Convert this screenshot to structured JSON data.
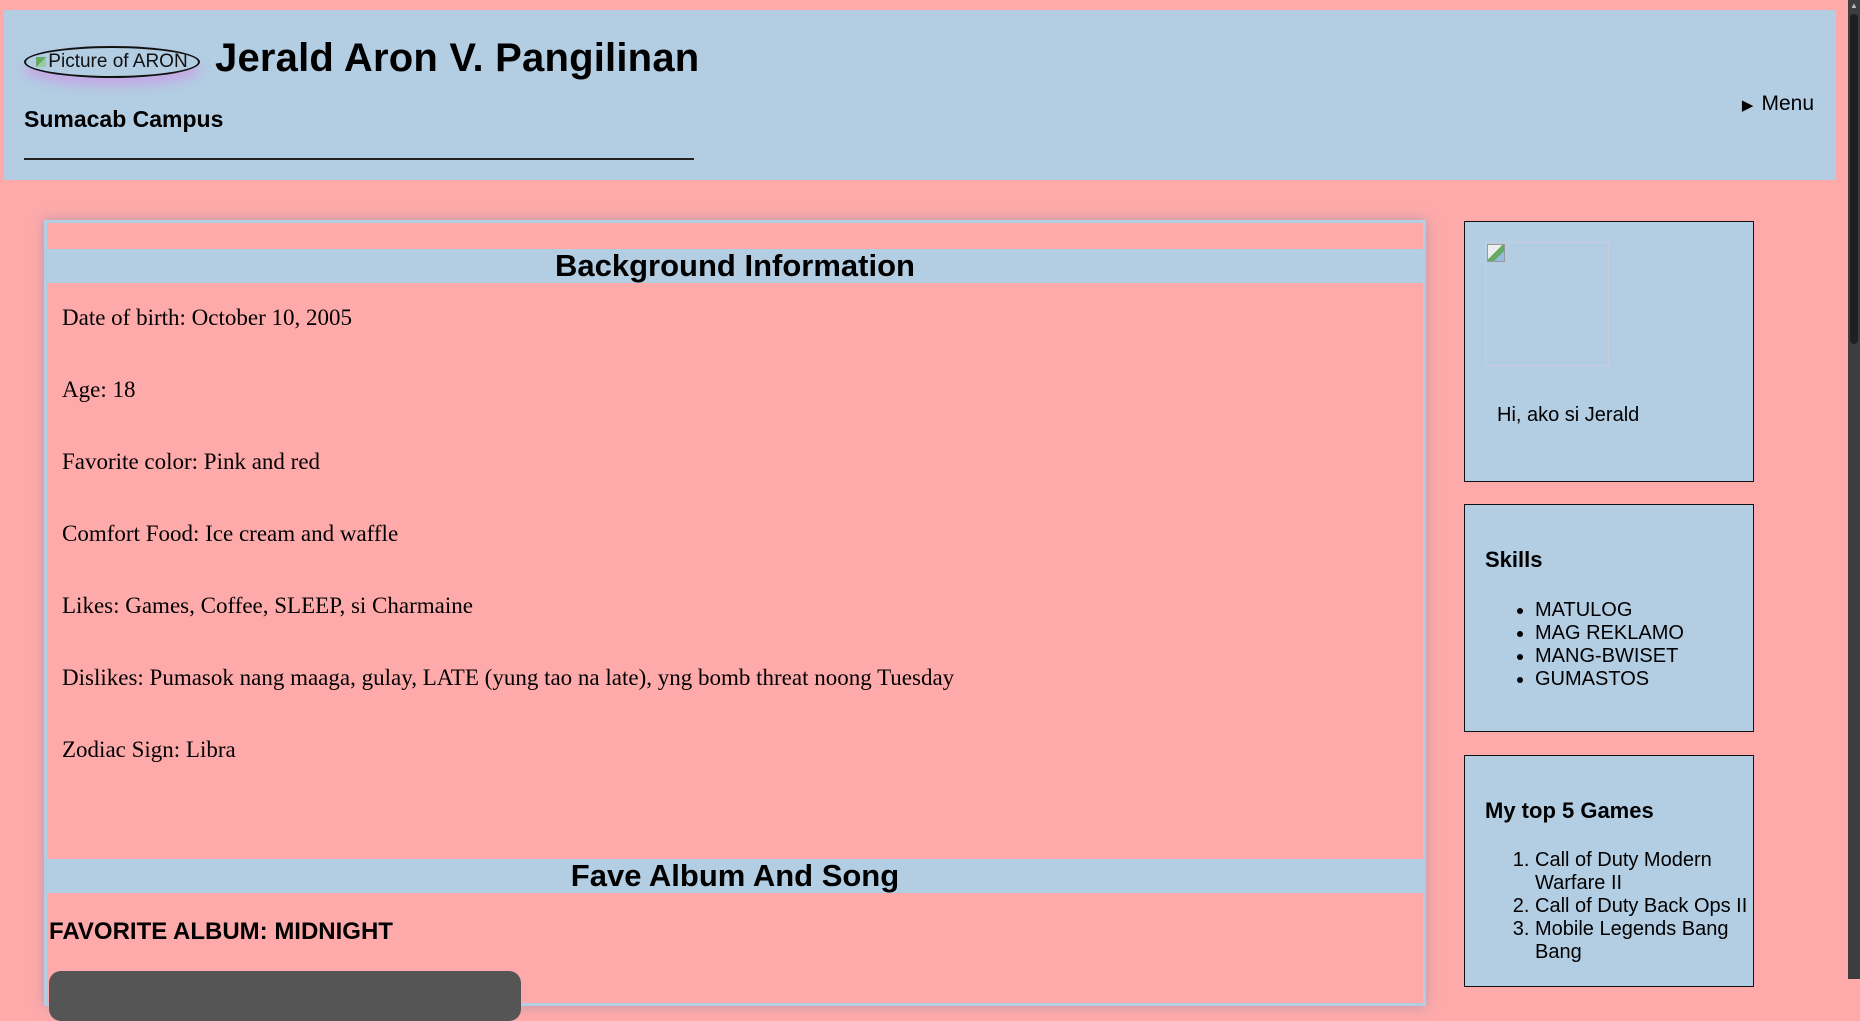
{
  "header": {
    "logo_alt": "Picture of ARON",
    "name": "Jerald Aron V. Pangilinan",
    "campus": "Sumacab Campus",
    "menu_label": "Menu",
    "menu_icon": "triangle-right-icon"
  },
  "background": {
    "title": "Background Information",
    "lines": [
      "Date of birth: October 10, 2005",
      "Age: 18",
      "Favorite color: Pink and red",
      "Comfort Food: Ice cream and waffle",
      "Likes: Games, Coffee, SLEEP, si Charmaine",
      "Dislikes: Pumasok nang maaga, gulay, LATE (yung tao na late), yng bomb threat noong Tuesday",
      "Zodiac Sign: Libra"
    ]
  },
  "fave": {
    "title": "Fave Album And Song",
    "album": "FAVORITE ALBUM: MIDNIGHT"
  },
  "profile": {
    "greeting": "Hi, ako si Jerald"
  },
  "skills": {
    "title": "Skills",
    "items": [
      "MATULOG",
      "MAG REKLAMO",
      "MANG-BWISET",
      "GUMASTOS"
    ]
  },
  "games": {
    "title": "My top 5 Games",
    "items": [
      "Call of Duty Modern Warfare II",
      "Call of Duty Back Ops II",
      "Mobile Legends Bang Bang"
    ]
  },
  "colors": {
    "page_background": "#ffaaaa",
    "panel_blue": "#b3cde3"
  }
}
